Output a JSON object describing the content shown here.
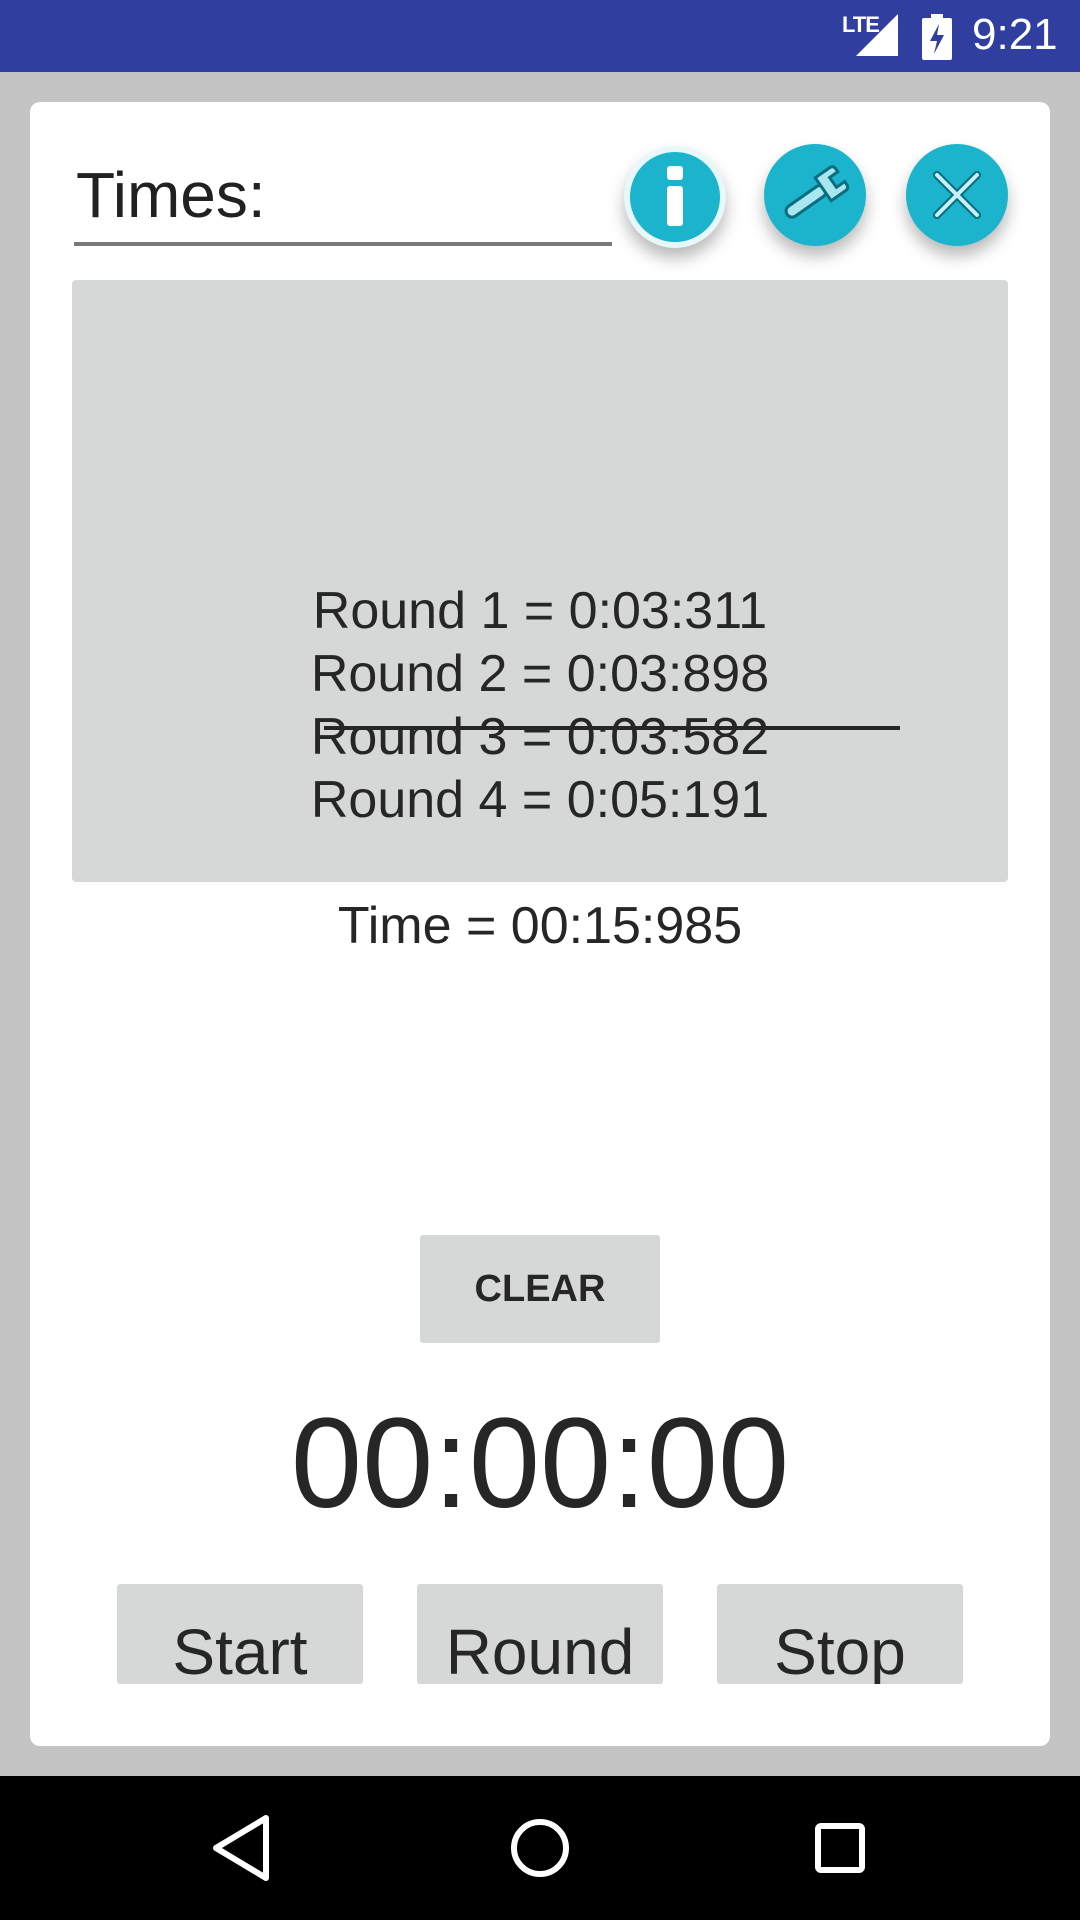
{
  "status_bar": {
    "network": "LTE",
    "time": "9:21"
  },
  "times_field": {
    "value": "Times:"
  },
  "header_buttons": {
    "info_icon": "info-icon",
    "settings_icon": "wrench-icon",
    "close_icon": "close-icon",
    "accent_color": "#1cb4cc"
  },
  "log": {
    "rounds": [
      "Round 1 = 0:03:311",
      "Round 2 = 0:03:898",
      "Round 3 = 0:03:582",
      "Round 4 = 0:05:191"
    ],
    "total": "Time = 00:15:985"
  },
  "clear_button": "CLEAR",
  "timer_display": "00:00:00",
  "controls": {
    "start": "Start",
    "round": "Round",
    "stop": "Stop"
  },
  "nav": {
    "back_icon": "back-icon",
    "home_icon": "home-icon",
    "recents_icon": "recents-icon"
  },
  "colors": {
    "status_bar": "#303f9f",
    "panel": "#d6d7d7",
    "background": "#c4c4c4"
  }
}
